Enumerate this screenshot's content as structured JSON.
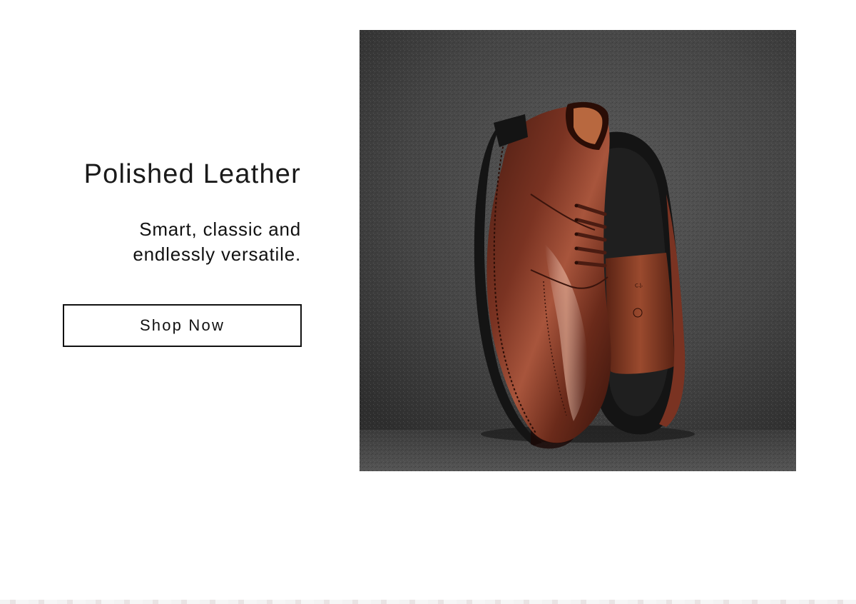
{
  "promo": {
    "title": "Polished Leather",
    "subtitle_line1": "Smart, classic and",
    "subtitle_line2": "endlessly versatile.",
    "cta_label": "Shop Now"
  },
  "hero_image": {
    "alt": "Brown polished leather derby shoes on grey felt",
    "colors": {
      "felt": "#4a4a4a",
      "leather": "#6b2a1c",
      "sole": "#161616"
    }
  }
}
